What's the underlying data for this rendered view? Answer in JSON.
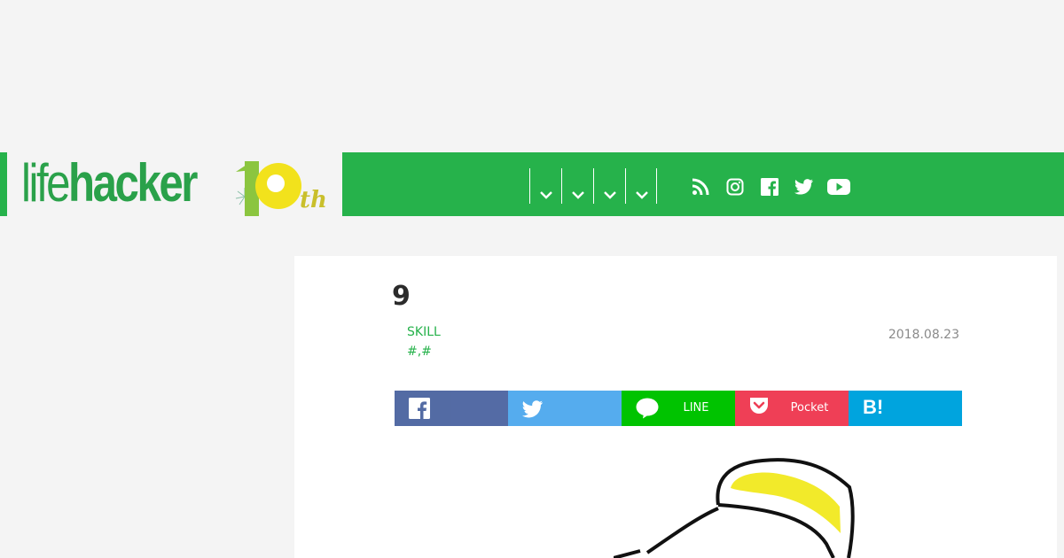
{
  "header": {
    "logo_light": "life",
    "logo_bold": "hacker",
    "logo_anniversary_number": "10",
    "logo_anniversary_suffix": "th",
    "nav_dropdowns": [
      "",
      "",
      "",
      ""
    ],
    "social_icons": [
      "rss-icon",
      "instagram-icon",
      "facebook-icon",
      "twitter-icon",
      "youtube-icon"
    ]
  },
  "article": {
    "title": "9",
    "category": "SKILL",
    "tags": "#,#",
    "date": "2018.08.23"
  },
  "share": {
    "facebook_label": "",
    "twitter_label": "",
    "line_label": "LINE",
    "pocket_label": "Pocket",
    "hatena_label": "B!"
  },
  "colors": {
    "brand_green": "#26b24b",
    "background": "#f4f4f4",
    "facebook": "#47609e",
    "twitter": "#55acee",
    "line": "#00c300",
    "pocket": "#ef3f56",
    "hatena": "#00a4de"
  }
}
